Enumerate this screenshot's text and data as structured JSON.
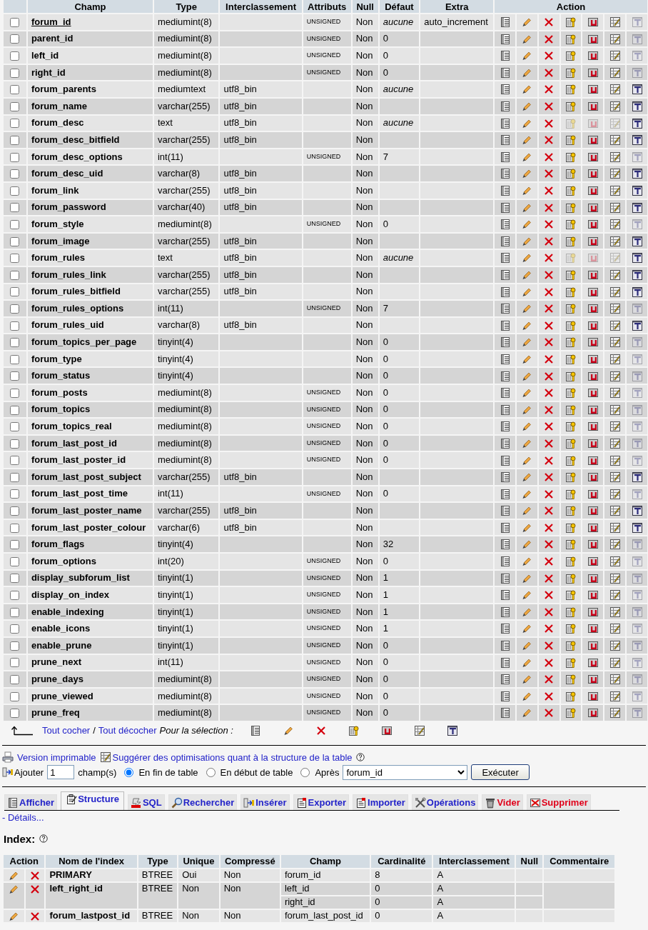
{
  "table": {
    "columns": [
      "Champ",
      "Type",
      "Interclassement",
      "Attributs",
      "Null",
      "Défaut",
      "Extra",
      "Action"
    ],
    "rows": [
      {
        "name": "forum_id",
        "primary": true,
        "type": "mediumint(8)",
        "attributes": "UNSIGNED",
        "null": "Non",
        "default": "aucune",
        "default_is_none": true,
        "extra": "auto_increment",
        "checked": false,
        "keys_disabled": false,
        "fulltext_enabled": false
      },
      {
        "name": "parent_id",
        "primary": false,
        "type": "mediumint(8)",
        "attributes": "UNSIGNED",
        "null": "Non",
        "default": "0",
        "default_is_none": false,
        "checked": false,
        "keys_disabled": false,
        "fulltext_enabled": false
      },
      {
        "name": "left_id",
        "primary": false,
        "type": "mediumint(8)",
        "attributes": "UNSIGNED",
        "null": "Non",
        "default": "0",
        "default_is_none": false,
        "checked": false,
        "keys_disabled": false,
        "fulltext_enabled": false
      },
      {
        "name": "right_id",
        "primary": false,
        "type": "mediumint(8)",
        "attributes": "UNSIGNED",
        "null": "Non",
        "default": "0",
        "default_is_none": false,
        "checked": false,
        "keys_disabled": false,
        "fulltext_enabled": false
      },
      {
        "name": "forum_parents",
        "primary": false,
        "type": "mediumtext",
        "collation": "utf8_bin",
        "null": "Non",
        "default": "aucune",
        "default_is_none": true,
        "checked": false,
        "keys_disabled": false,
        "fulltext_enabled": true
      },
      {
        "name": "forum_name",
        "primary": false,
        "type": "varchar(255)",
        "collation": "utf8_bin",
        "null": "Non",
        "checked": false,
        "keys_disabled": false,
        "fulltext_enabled": true
      },
      {
        "name": "forum_desc",
        "primary": false,
        "type": "text",
        "collation": "utf8_bin",
        "null": "Non",
        "default": "aucune",
        "default_is_none": true,
        "checked": false,
        "keys_disabled": true,
        "fulltext_enabled": true
      },
      {
        "name": "forum_desc_bitfield",
        "primary": false,
        "type": "varchar(255)",
        "collation": "utf8_bin",
        "null": "Non",
        "checked": false,
        "keys_disabled": false,
        "fulltext_enabled": true
      },
      {
        "name": "forum_desc_options",
        "primary": false,
        "type": "int(11)",
        "attributes": "UNSIGNED",
        "null": "Non",
        "default": "7",
        "default_is_none": false,
        "checked": false,
        "keys_disabled": false,
        "fulltext_enabled": false
      },
      {
        "name": "forum_desc_uid",
        "primary": false,
        "type": "varchar(8)",
        "collation": "utf8_bin",
        "null": "Non",
        "checked": false,
        "keys_disabled": false,
        "fulltext_enabled": true
      },
      {
        "name": "forum_link",
        "primary": false,
        "type": "varchar(255)",
        "collation": "utf8_bin",
        "null": "Non",
        "checked": false,
        "keys_disabled": false,
        "fulltext_enabled": true
      },
      {
        "name": "forum_password",
        "primary": false,
        "type": "varchar(40)",
        "collation": "utf8_bin",
        "null": "Non",
        "checked": false,
        "keys_disabled": false,
        "fulltext_enabled": true
      },
      {
        "name": "forum_style",
        "primary": false,
        "type": "mediumint(8)",
        "attributes": "UNSIGNED",
        "null": "Non",
        "default": "0",
        "default_is_none": false,
        "checked": false,
        "keys_disabled": false,
        "fulltext_enabled": false
      },
      {
        "name": "forum_image",
        "primary": false,
        "type": "varchar(255)",
        "collation": "utf8_bin",
        "null": "Non",
        "checked": false,
        "keys_disabled": false,
        "fulltext_enabled": true
      },
      {
        "name": "forum_rules",
        "primary": false,
        "type": "text",
        "collation": "utf8_bin",
        "null": "Non",
        "default": "aucune",
        "default_is_none": true,
        "checked": false,
        "keys_disabled": true,
        "fulltext_enabled": true
      },
      {
        "name": "forum_rules_link",
        "primary": false,
        "type": "varchar(255)",
        "collation": "utf8_bin",
        "null": "Non",
        "checked": false,
        "keys_disabled": false,
        "fulltext_enabled": true
      },
      {
        "name": "forum_rules_bitfield",
        "primary": false,
        "type": "varchar(255)",
        "collation": "utf8_bin",
        "null": "Non",
        "checked": false,
        "keys_disabled": false,
        "fulltext_enabled": true
      },
      {
        "name": "forum_rules_options",
        "primary": false,
        "type": "int(11)",
        "attributes": "UNSIGNED",
        "null": "Non",
        "default": "7",
        "default_is_none": false,
        "checked": false,
        "keys_disabled": false,
        "fulltext_enabled": false
      },
      {
        "name": "forum_rules_uid",
        "primary": false,
        "type": "varchar(8)",
        "collation": "utf8_bin",
        "null": "Non",
        "checked": false,
        "keys_disabled": false,
        "fulltext_enabled": true
      },
      {
        "name": "forum_topics_per_page",
        "primary": false,
        "type": "tinyint(4)",
        "null": "Non",
        "default": "0",
        "default_is_none": false,
        "checked": false,
        "keys_disabled": false,
        "fulltext_enabled": false
      },
      {
        "name": "forum_type",
        "primary": false,
        "type": "tinyint(4)",
        "null": "Non",
        "default": "0",
        "default_is_none": false,
        "checked": false,
        "keys_disabled": false,
        "fulltext_enabled": false
      },
      {
        "name": "forum_status",
        "primary": false,
        "type": "tinyint(4)",
        "null": "Non",
        "default": "0",
        "default_is_none": false,
        "checked": false,
        "keys_disabled": false,
        "fulltext_enabled": false
      },
      {
        "name": "forum_posts",
        "primary": false,
        "type": "mediumint(8)",
        "attributes": "UNSIGNED",
        "null": "Non",
        "default": "0",
        "default_is_none": false,
        "checked": false,
        "keys_disabled": false,
        "fulltext_enabled": false
      },
      {
        "name": "forum_topics",
        "primary": false,
        "type": "mediumint(8)",
        "attributes": "UNSIGNED",
        "null": "Non",
        "default": "0",
        "default_is_none": false,
        "checked": false,
        "keys_disabled": false,
        "fulltext_enabled": false
      },
      {
        "name": "forum_topics_real",
        "primary": false,
        "type": "mediumint(8)",
        "attributes": "UNSIGNED",
        "null": "Non",
        "default": "0",
        "default_is_none": false,
        "checked": false,
        "keys_disabled": false,
        "fulltext_enabled": false
      },
      {
        "name": "forum_last_post_id",
        "primary": false,
        "type": "mediumint(8)",
        "attributes": "UNSIGNED",
        "null": "Non",
        "default": "0",
        "default_is_none": false,
        "checked": false,
        "keys_disabled": false,
        "fulltext_enabled": false
      },
      {
        "name": "forum_last_poster_id",
        "primary": false,
        "type": "mediumint(8)",
        "attributes": "UNSIGNED",
        "null": "Non",
        "default": "0",
        "default_is_none": false,
        "checked": false,
        "keys_disabled": false,
        "fulltext_enabled": false
      },
      {
        "name": "forum_last_post_subject",
        "primary": false,
        "type": "varchar(255)",
        "collation": "utf8_bin",
        "null": "Non",
        "checked": false,
        "keys_disabled": false,
        "fulltext_enabled": true
      },
      {
        "name": "forum_last_post_time",
        "primary": false,
        "type": "int(11)",
        "attributes": "UNSIGNED",
        "null": "Non",
        "default": "0",
        "default_is_none": false,
        "checked": false,
        "keys_disabled": false,
        "fulltext_enabled": false
      },
      {
        "name": "forum_last_poster_name",
        "primary": false,
        "type": "varchar(255)",
        "collation": "utf8_bin",
        "null": "Non",
        "checked": false,
        "keys_disabled": false,
        "fulltext_enabled": true
      },
      {
        "name": "forum_last_poster_colour",
        "primary": false,
        "type": "varchar(6)",
        "collation": "utf8_bin",
        "null": "Non",
        "checked": false,
        "keys_disabled": false,
        "fulltext_enabled": true
      },
      {
        "name": "forum_flags",
        "primary": false,
        "type": "tinyint(4)",
        "null": "Non",
        "default": "32",
        "default_is_none": false,
        "checked": false,
        "keys_disabled": false,
        "fulltext_enabled": false
      },
      {
        "name": "forum_options",
        "primary": false,
        "type": "int(20)",
        "attributes": "UNSIGNED",
        "null": "Non",
        "default": "0",
        "default_is_none": false,
        "checked": false,
        "keys_disabled": false,
        "fulltext_enabled": false
      },
      {
        "name": "display_subforum_list",
        "primary": false,
        "type": "tinyint(1)",
        "attributes": "UNSIGNED",
        "null": "Non",
        "default": "1",
        "default_is_none": false,
        "checked": false,
        "keys_disabled": false,
        "fulltext_enabled": false
      },
      {
        "name": "display_on_index",
        "primary": false,
        "type": "tinyint(1)",
        "attributes": "UNSIGNED",
        "null": "Non",
        "default": "1",
        "default_is_none": false,
        "checked": false,
        "keys_disabled": false,
        "fulltext_enabled": false
      },
      {
        "name": "enable_indexing",
        "primary": false,
        "type": "tinyint(1)",
        "attributes": "UNSIGNED",
        "null": "Non",
        "default": "1",
        "default_is_none": false,
        "checked": false,
        "keys_disabled": false,
        "fulltext_enabled": false
      },
      {
        "name": "enable_icons",
        "primary": false,
        "type": "tinyint(1)",
        "attributes": "UNSIGNED",
        "null": "Non",
        "default": "1",
        "default_is_none": false,
        "checked": false,
        "keys_disabled": false,
        "fulltext_enabled": false
      },
      {
        "name": "enable_prune",
        "primary": false,
        "type": "tinyint(1)",
        "attributes": "UNSIGNED",
        "null": "Non",
        "default": "0",
        "default_is_none": false,
        "checked": false,
        "keys_disabled": false,
        "fulltext_enabled": false
      },
      {
        "name": "prune_next",
        "primary": false,
        "type": "int(11)",
        "attributes": "UNSIGNED",
        "null": "Non",
        "default": "0",
        "default_is_none": false,
        "checked": false,
        "keys_disabled": false,
        "fulltext_enabled": false
      },
      {
        "name": "prune_days",
        "primary": false,
        "type": "mediumint(8)",
        "attributes": "UNSIGNED",
        "null": "Non",
        "default": "0",
        "default_is_none": false,
        "checked": false,
        "keys_disabled": false,
        "fulltext_enabled": false
      },
      {
        "name": "prune_viewed",
        "primary": false,
        "type": "mediumint(8)",
        "attributes": "UNSIGNED",
        "null": "Non",
        "default": "0",
        "default_is_none": false,
        "checked": false,
        "keys_disabled": false,
        "fulltext_enabled": false
      },
      {
        "name": "prune_freq",
        "primary": false,
        "type": "mediumint(8)",
        "attributes": "UNSIGNED",
        "null": "Non",
        "default": "0",
        "default_is_none": false,
        "checked": false,
        "keys_disabled": false,
        "fulltext_enabled": false
      }
    ]
  },
  "selection_bar": {
    "check_all": "Tout cocher",
    "separator": "/",
    "uncheck_all": "Tout décocher",
    "label": "Pour la sélection :"
  },
  "links": {
    "print": "Version imprimable",
    "optimize": "Suggérer des optimisations quant à la structure de la table"
  },
  "add_fields": {
    "label": "Ajouter",
    "count": "1",
    "unit": "champ(s)",
    "positions": [
      {
        "label": "En fin de table",
        "selected": true
      },
      {
        "label": "En début de table",
        "selected": false
      },
      {
        "label": "Après",
        "selected": false
      }
    ],
    "after_column": "forum_id",
    "submit": "Exécuter"
  },
  "tabs": [
    {
      "label": "Afficher",
      "selected": false,
      "danger": false
    },
    {
      "label": "Structure",
      "selected": true,
      "danger": false
    },
    {
      "label": "SQL",
      "selected": false,
      "danger": false
    },
    {
      "label": "Rechercher",
      "selected": false,
      "danger": false
    },
    {
      "label": "Insérer",
      "selected": false,
      "danger": false
    },
    {
      "label": "Exporter",
      "selected": false,
      "danger": false
    },
    {
      "label": "Importer",
      "selected": false,
      "danger": false
    },
    {
      "label": "Opérations",
      "selected": false,
      "danger": false
    },
    {
      "label": "Vider",
      "selected": false,
      "danger": true
    },
    {
      "label": "Supprimer",
      "selected": false,
      "danger": true
    }
  ],
  "details_link": "- Détails...",
  "index": {
    "title": "Index:",
    "columns": [
      "Action",
      "Nom de l'index",
      "Type",
      "Unique",
      "Compressé",
      "Champ",
      "Cardinalité",
      "Interclassement",
      "Null",
      "Commentaire"
    ],
    "rows": [
      {
        "name": "PRIMARY",
        "type": "BTREE",
        "unique": "Oui",
        "packed": "Non",
        "fields": [
          {
            "field": "forum_id",
            "cardinality": "8",
            "collation": "A"
          }
        ]
      },
      {
        "name": "left_right_id",
        "type": "BTREE",
        "unique": "Non",
        "packed": "Non",
        "fields": [
          {
            "field": "left_id",
            "cardinality": "0",
            "collation": "A"
          },
          {
            "field": "right_id",
            "cardinality": "0",
            "collation": "A"
          }
        ]
      },
      {
        "name": "forum_lastpost_id",
        "type": "BTREE",
        "unique": "Non",
        "packed": "Non",
        "fields": [
          {
            "field": "forum_last_post_id",
            "cardinality": "0",
            "collation": "A"
          }
        ]
      }
    ]
  }
}
